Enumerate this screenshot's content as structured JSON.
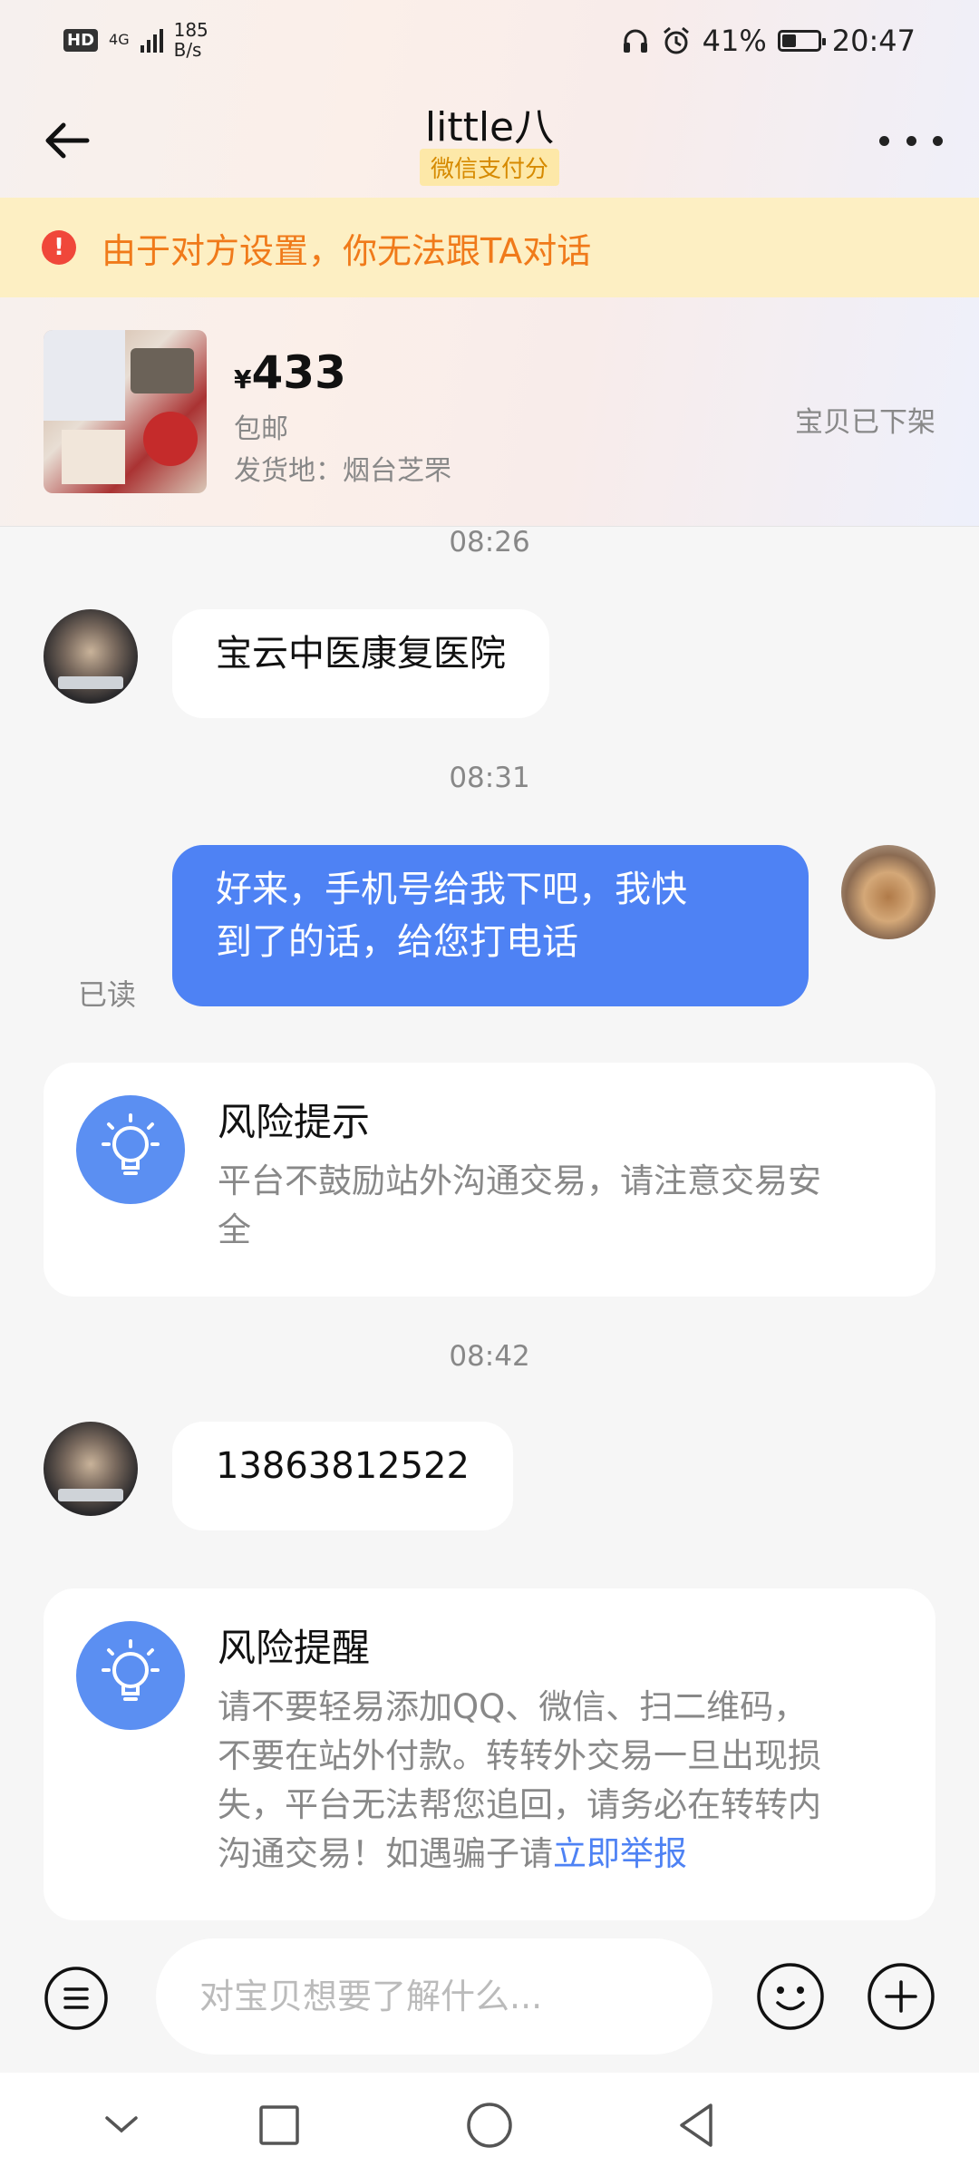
{
  "status_bar": {
    "hd": "HD",
    "network": "4G",
    "speed_value": "185",
    "speed_unit": "B/s",
    "battery_percent": "41%",
    "battery_level": 0.41,
    "time": "20:47"
  },
  "header": {
    "title": "little八",
    "badge": "微信支付分"
  },
  "warning": {
    "icon": "exclamation-icon",
    "text": "由于对方设置，你无法跟TA对话"
  },
  "product": {
    "currency": "¥",
    "price": "433",
    "shipping": "包邮",
    "origin": "发货地：烟台芝罘",
    "status": "宝贝已下架"
  },
  "messages": [
    {
      "type": "time",
      "text": "08:26"
    },
    {
      "type": "incoming",
      "text": "宝云中医康复医院"
    },
    {
      "type": "time",
      "text": "08:31"
    },
    {
      "type": "outgoing",
      "line1": "好来，手机号给我下吧，我快",
      "line2": "到了的话，给您打电话",
      "read_status": "已读"
    },
    {
      "type": "tip",
      "title": "风险提示",
      "line1": "平台不鼓励站外沟通交易，请注意交易安",
      "line2": "全"
    },
    {
      "type": "time",
      "text": "08:42"
    },
    {
      "type": "incoming",
      "text": "13863812522"
    },
    {
      "type": "tip",
      "title": "风险提醒",
      "line1": "请不要轻易添加QQ、微信、扫二维码，",
      "line2": "不要在站外付款。转转外交易一旦出现损",
      "line3": "失，平台无法帮您追回，请务必在转转内",
      "line4_prefix": "沟通交易！如遇骗子请",
      "link": "立即举报"
    }
  ],
  "input": {
    "placeholder": "对宝贝想要了解什么..."
  },
  "icons": {
    "back": "back-arrow-icon",
    "more": "more-dots-icon",
    "menu": "menu-icon",
    "emoji": "emoji-icon",
    "plus": "plus-icon",
    "bulb": "lightbulb-icon",
    "nav_down": "chevron-down-icon",
    "nav_recent": "square-icon",
    "nav_home": "circle-icon",
    "nav_back": "triangle-back-icon"
  },
  "colors": {
    "accent": "#4e82f4",
    "warning_bg": "#fdefc3",
    "warning_text": "#f07a1a",
    "badge_bg": "#fde8a8",
    "badge_text": "#d68a00"
  }
}
